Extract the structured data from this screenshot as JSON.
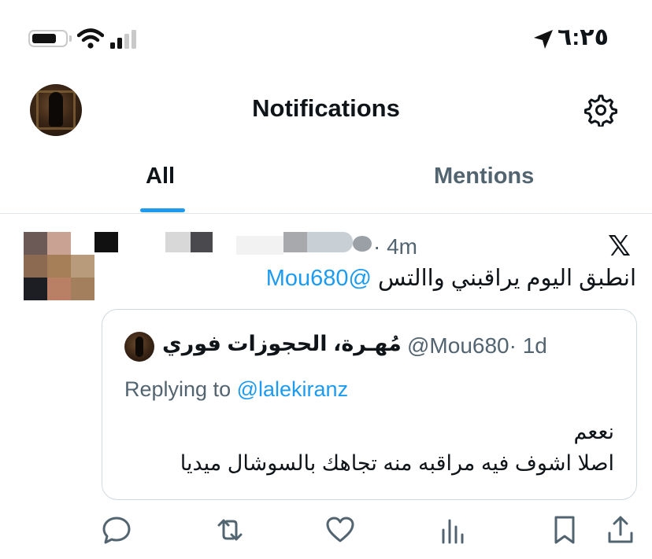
{
  "status_bar": {
    "time": "٦:٢٥",
    "icons": [
      "battery-icon",
      "wifi-icon",
      "signal-icon",
      "location-arrow-icon"
    ]
  },
  "header": {
    "title": "Notifications",
    "settings_icon": "gear-icon"
  },
  "tabs": [
    {
      "label": "All",
      "active": true
    },
    {
      "label": "Mentions",
      "active": false
    }
  ],
  "notification": {
    "time": "· 4m",
    "source_icon": "x-logo-icon",
    "text": "انطبق اليوم يراقبني واالتس",
    "mention": "@Mou680",
    "quoted": {
      "name": "مُهـرة، الحجوزات فوري",
      "handle": "@Mou680",
      "time": "· 1d",
      "replying_prefix": "Replying to",
      "replying_to": "@lalekiranz",
      "lines": [
        "نععم",
        "اصلا اشوف فيه مراقبه منه تجاهك بالسوشال ميديا"
      ]
    },
    "actions": [
      "reply-icon",
      "retweet-icon",
      "like-icon",
      "views-icon",
      "bookmark-icon",
      "share-icon"
    ]
  },
  "colors": {
    "accent": "#1d9bf0",
    "secondary_text": "#536471",
    "primary_text": "#0f1419",
    "border": "#cfd9de"
  }
}
